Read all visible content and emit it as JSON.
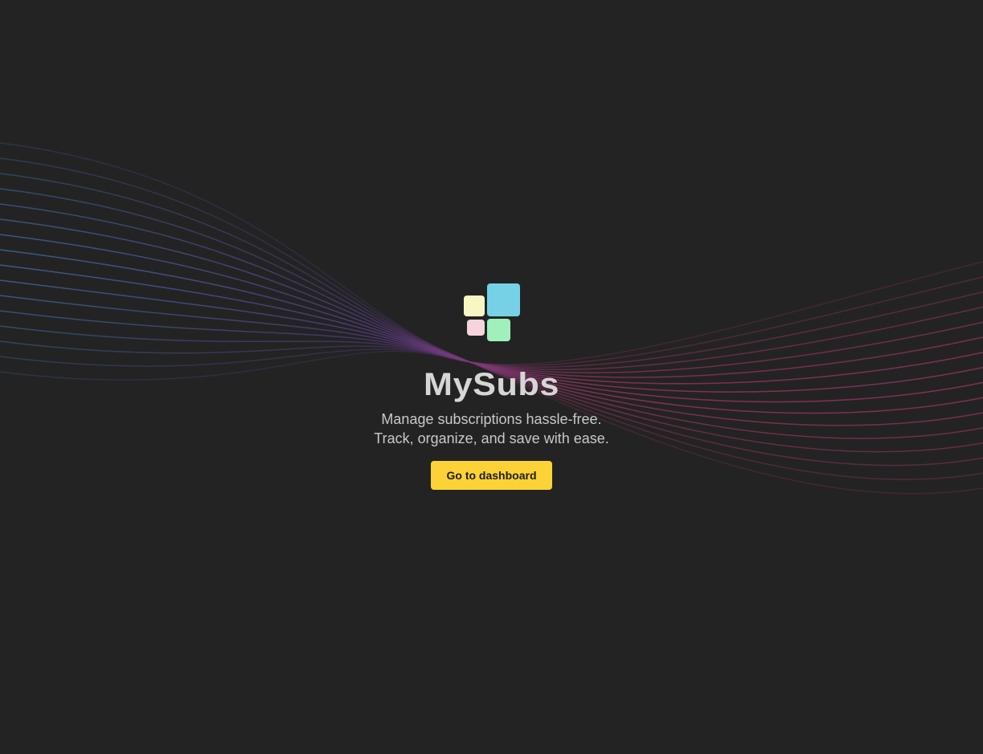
{
  "app": {
    "name": "MySubs",
    "tagline_line1": "Manage subscriptions hassle-free.",
    "tagline_line2": "Track, organize, and save with ease."
  },
  "cta": {
    "label": "Go to dashboard"
  },
  "logo": {
    "icon": "app-logo-grid-icon",
    "tiles": [
      {
        "name": "logo-tile-yellow",
        "color": "#f8f7c4"
      },
      {
        "name": "logo-tile-blue",
        "color": "#76d1e6"
      },
      {
        "name": "logo-tile-pink",
        "color": "#f6d4dc"
      },
      {
        "name": "logo-tile-green",
        "color": "#9ff0bb"
      }
    ]
  },
  "colors": {
    "background": "#232323",
    "accent": "#fdd236",
    "wave_blue": "#3f6fa8",
    "wave_purple": "#5a3d8a",
    "wave_pink": "#a13465"
  }
}
